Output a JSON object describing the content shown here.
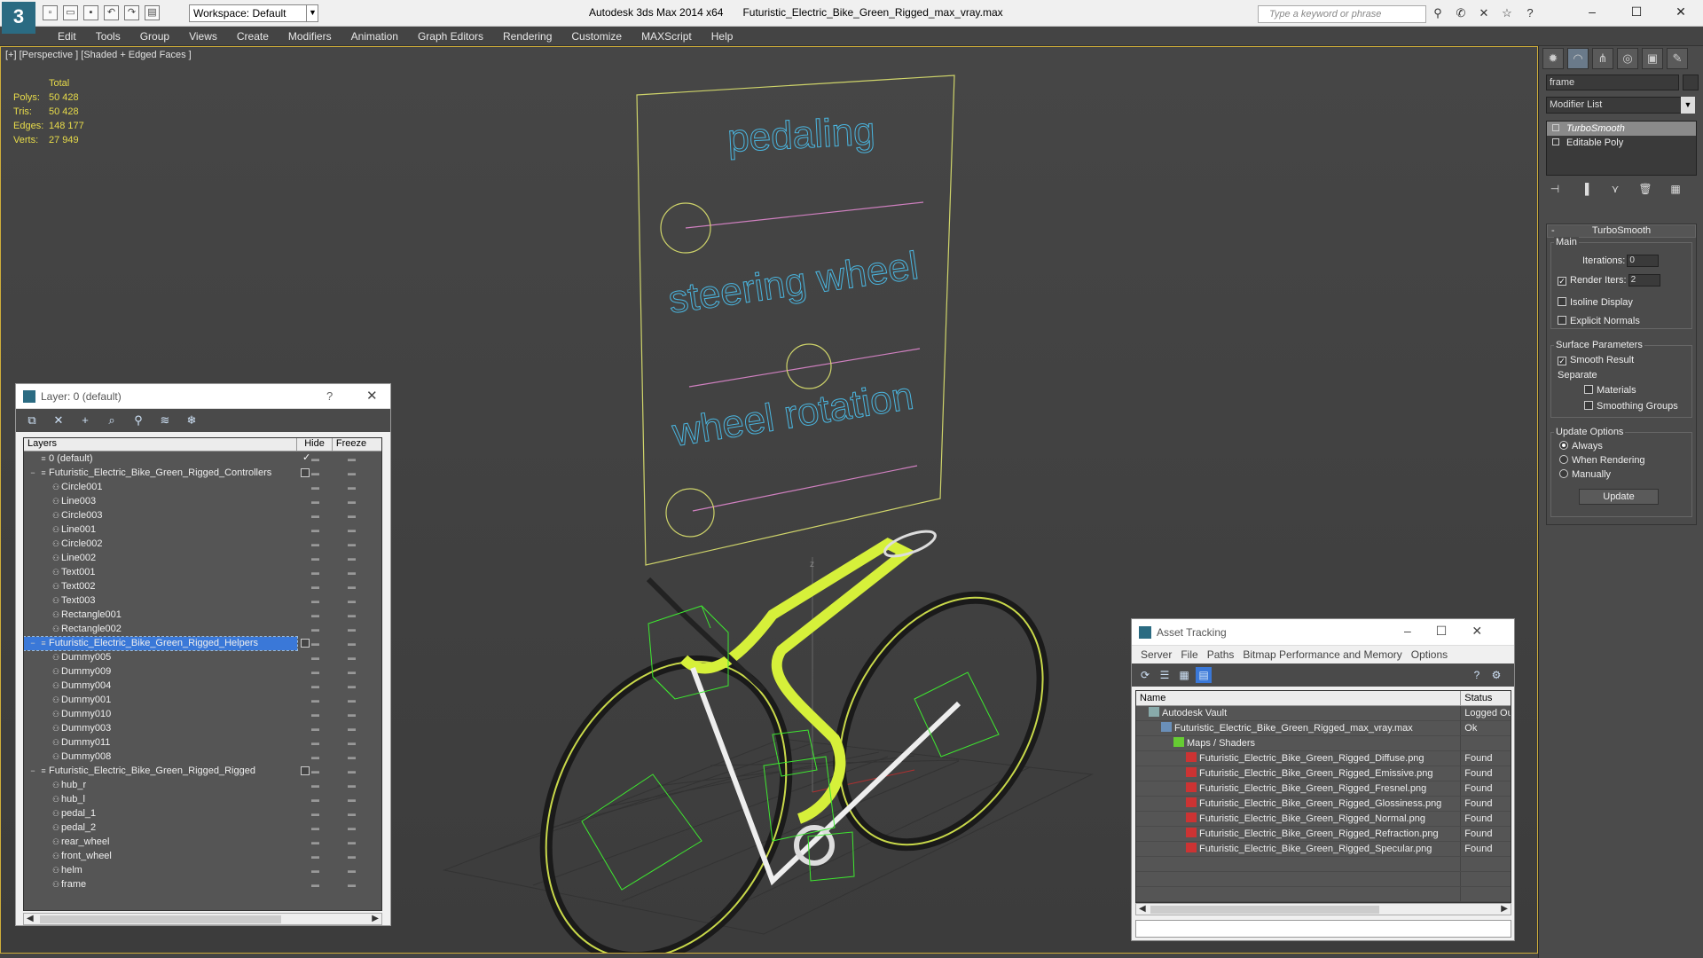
{
  "titlebar": {
    "workspace": "Workspace: Default",
    "app_name": "Autodesk 3ds Max  2014 x64",
    "file_name": "Futuristic_Electric_Bike_Green_Rigged_max_vray.max",
    "search_placeholder": "Type a keyword or phrase",
    "window_controls": [
      "–",
      "☐",
      "✕"
    ]
  },
  "menu": [
    "Edit",
    "Tools",
    "Group",
    "Views",
    "Create",
    "Modifiers",
    "Animation",
    "Graph Editors",
    "Rendering",
    "Customize",
    "MAXScript",
    "Help"
  ],
  "viewport": {
    "label": "[+] [Perspective ] [Shaded + Edged Faces ]",
    "stats_header": "Total",
    "stats": [
      {
        "k": "Polys:",
        "v": "50 428"
      },
      {
        "k": "Tris:",
        "v": "50 428"
      },
      {
        "k": "Edges:",
        "v": "148 177"
      },
      {
        "k": "Verts:",
        "v": "27 949"
      }
    ],
    "board_labels": [
      "pedaling",
      "steering wheel",
      "wheel rotation"
    ],
    "axis_label": "z",
    "colors": {
      "board": "#cfd46a",
      "text": "#4ab6e0",
      "slider": "#d080c0",
      "bike": "#d6f03a",
      "helper": "#3ee830",
      "grid": "#2e2e2e"
    }
  },
  "layer_window": {
    "title": "Layer: 0 (default)",
    "help": "?",
    "close": "✕",
    "col_layers": "Layers",
    "col_hide": "Hide",
    "col_freeze": "Freeze",
    "rows": [
      {
        "name": "0 (default)",
        "level": 1,
        "type": "layer",
        "current": true
      },
      {
        "name": "Futuristic_Electric_Bike_Green_Rigged_Controllers",
        "level": 0,
        "type": "layer"
      },
      {
        "name": "Circle001",
        "level": 2,
        "type": "obj"
      },
      {
        "name": "Line003",
        "level": 2,
        "type": "obj"
      },
      {
        "name": "Circle003",
        "level": 2,
        "type": "obj"
      },
      {
        "name": "Line001",
        "level": 2,
        "type": "obj"
      },
      {
        "name": "Circle002",
        "level": 2,
        "type": "obj"
      },
      {
        "name": "Line002",
        "level": 2,
        "type": "obj"
      },
      {
        "name": "Text001",
        "level": 2,
        "type": "obj"
      },
      {
        "name": "Text002",
        "level": 2,
        "type": "obj"
      },
      {
        "name": "Text003",
        "level": 2,
        "type": "obj"
      },
      {
        "name": "Rectangle001",
        "level": 2,
        "type": "obj"
      },
      {
        "name": "Rectangle002",
        "level": 2,
        "type": "obj"
      },
      {
        "name": "Futuristic_Electric_Bike_Green_Rigged_Helpers",
        "level": 0,
        "type": "layer",
        "selected": true
      },
      {
        "name": "Dummy005",
        "level": 2,
        "type": "obj"
      },
      {
        "name": "Dummy009",
        "level": 2,
        "type": "obj"
      },
      {
        "name": "Dummy004",
        "level": 2,
        "type": "obj"
      },
      {
        "name": "Dummy001",
        "level": 2,
        "type": "obj"
      },
      {
        "name": "Dummy010",
        "level": 2,
        "type": "obj"
      },
      {
        "name": "Dummy003",
        "level": 2,
        "type": "obj"
      },
      {
        "name": "Dummy011",
        "level": 2,
        "type": "obj"
      },
      {
        "name": "Dummy008",
        "level": 2,
        "type": "obj"
      },
      {
        "name": "Futuristic_Electric_Bike_Green_Rigged_Rigged",
        "level": 0,
        "type": "layer"
      },
      {
        "name": "hub_r",
        "level": 2,
        "type": "obj"
      },
      {
        "name": "hub_l",
        "level": 2,
        "type": "obj"
      },
      {
        "name": "pedal_1",
        "level": 2,
        "type": "obj"
      },
      {
        "name": "pedal_2",
        "level": 2,
        "type": "obj"
      },
      {
        "name": "rear_wheel",
        "level": 2,
        "type": "obj"
      },
      {
        "name": "front_wheel",
        "level": 2,
        "type": "obj"
      },
      {
        "name": "helm",
        "level": 2,
        "type": "obj"
      },
      {
        "name": "frame",
        "level": 2,
        "type": "obj"
      }
    ]
  },
  "asset_window": {
    "title": "Asset Tracking",
    "menu": [
      "Server",
      "File",
      "Paths",
      "Bitmap Performance and Memory",
      "Options"
    ],
    "col_name": "Name",
    "col_status": "Status",
    "rows": [
      {
        "name": "Autodesk Vault",
        "status": "Logged Out",
        "indent": 0,
        "icon": "vault"
      },
      {
        "name": "Futuristic_Electric_Bike_Green_Rigged_max_vray.max",
        "status": "Ok",
        "indent": 1,
        "icon": "max"
      },
      {
        "name": "Maps / Shaders",
        "status": "",
        "indent": 2,
        "icon": "folder"
      },
      {
        "name": "Futuristic_Electric_Bike_Green_Rigged_Diffuse.png",
        "status": "Found",
        "indent": 3,
        "icon": "png"
      },
      {
        "name": "Futuristic_Electric_Bike_Green_Rigged_Emissive.png",
        "status": "Found",
        "indent": 3,
        "icon": "png"
      },
      {
        "name": "Futuristic_Electric_Bike_Green_Rigged_Fresnel.png",
        "status": "Found",
        "indent": 3,
        "icon": "png"
      },
      {
        "name": "Futuristic_Electric_Bike_Green_Rigged_Glossiness.png",
        "status": "Found",
        "indent": 3,
        "icon": "png"
      },
      {
        "name": "Futuristic_Electric_Bike_Green_Rigged_Normal.png",
        "status": "Found",
        "indent": 3,
        "icon": "png"
      },
      {
        "name": "Futuristic_Electric_Bike_Green_Rigged_Refraction.png",
        "status": "Found",
        "indent": 3,
        "icon": "png"
      },
      {
        "name": "Futuristic_Electric_Bike_Green_Rigged_Specular.png",
        "status": "Found",
        "indent": 3,
        "icon": "png"
      }
    ]
  },
  "command_panel": {
    "object_name": "frame",
    "modifier_list": "Modifier List",
    "stack": [
      "TurboSmooth",
      "Editable Poly"
    ],
    "rollout_title": "TurboSmooth",
    "main_label": "Main",
    "iterations_label": "Iterations:",
    "iterations_value": "0",
    "render_iters_label": "Render Iters:",
    "render_iters_value": "2",
    "isoline_label": "Isoline Display",
    "explicit_normals_label": "Explicit Normals",
    "surface_params_label": "Surface Parameters",
    "smooth_result_label": "Smooth Result",
    "separate_label": "Separate",
    "materials_label": "Materials",
    "smoothing_groups_label": "Smoothing Groups",
    "update_options_label": "Update Options",
    "always_label": "Always",
    "when_rendering_label": "When Rendering",
    "manually_label": "Manually",
    "update_button": "Update"
  }
}
